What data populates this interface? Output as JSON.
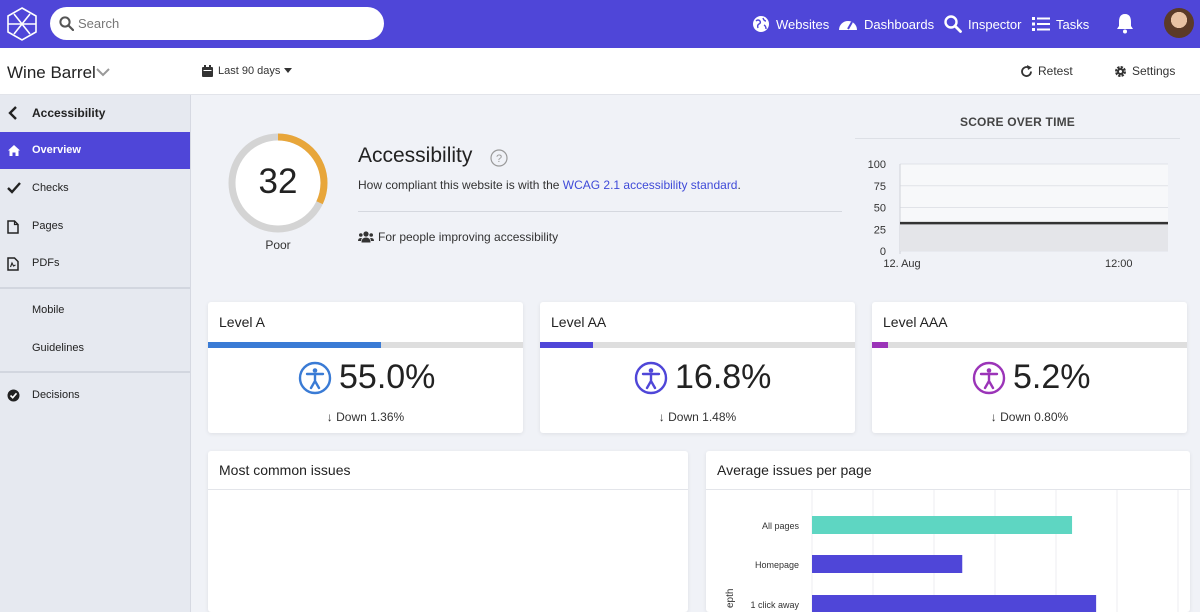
{
  "header": {
    "search_placeholder": "Search",
    "nav": [
      {
        "label": "Websites",
        "icon": "globe-icon"
      },
      {
        "label": "Dashboards",
        "icon": "dashboard-gauge-icon"
      },
      {
        "label": "Inspector",
        "icon": "magnifier-icon"
      },
      {
        "label": "Tasks",
        "icon": "list-icon"
      }
    ],
    "bell_icon": "bell-icon",
    "accent_color": "#4f46d8"
  },
  "subheader": {
    "site_name": "Wine Barrel",
    "date_range": "Last 90 days",
    "retest_label": "Retest",
    "settings_label": "Settings"
  },
  "sidebar": {
    "back_label": "Accessibility",
    "items": [
      {
        "label": "Overview",
        "icon": "home-icon",
        "active": true
      },
      {
        "label": "Checks",
        "icon": "checkmark-icon"
      },
      {
        "label": "Pages",
        "icon": "page-icon"
      },
      {
        "label": "PDFs",
        "icon": "pdf-icon"
      },
      {
        "label": "Mobile"
      },
      {
        "label": "Guidelines"
      },
      {
        "label": "Decisions",
        "icon": "check-circle-icon"
      }
    ]
  },
  "hero": {
    "score": "32",
    "score_fraction": 0.32,
    "rating": "Poor",
    "title": "Accessibility",
    "description_prefix": "How compliant this website is with the ",
    "link_text": "WCAG 2.1 accessibility standard",
    "description_suffix": ".",
    "audience": "For people improving accessibility"
  },
  "score_over_time": {
    "title": "SCORE OVER TIME",
    "chart_data": {
      "type": "line",
      "x_labels": [
        "12. Aug",
        "12:00"
      ],
      "y_ticks": [
        100,
        75,
        50,
        25,
        0
      ],
      "ylim": [
        0,
        100
      ],
      "series": [
        {
          "values": [
            32,
            32
          ]
        }
      ],
      "grid": true
    }
  },
  "levels": [
    {
      "title": "Level A",
      "value": "55.0%",
      "fraction": 0.55,
      "delta": "Down 1.36%",
      "color": "#3a7bd5"
    },
    {
      "title": "Level AA",
      "value": "16.8%",
      "fraction": 0.168,
      "delta": "Down 1.48%",
      "color": "#4f46d8"
    },
    {
      "title": "Level AAA",
      "value": "5.2%",
      "fraction": 0.052,
      "delta": "Down 0.80%",
      "color": "#9b34b8"
    }
  ],
  "most_common_issues": {
    "title": "Most common issues"
  },
  "average_issues": {
    "title": "Average issues per page",
    "chart_data": {
      "type": "bar",
      "orientation": "horizontal",
      "categories": [
        "All pages",
        "Homepage",
        "1 click away"
      ],
      "values": [
        27,
        15.6,
        29.5
      ],
      "colors": [
        "#5ed6c2",
        "#4f46d8",
        "#4f46d8"
      ],
      "ylabel": "epth",
      "xlim": [
        0,
        38
      ]
    }
  }
}
